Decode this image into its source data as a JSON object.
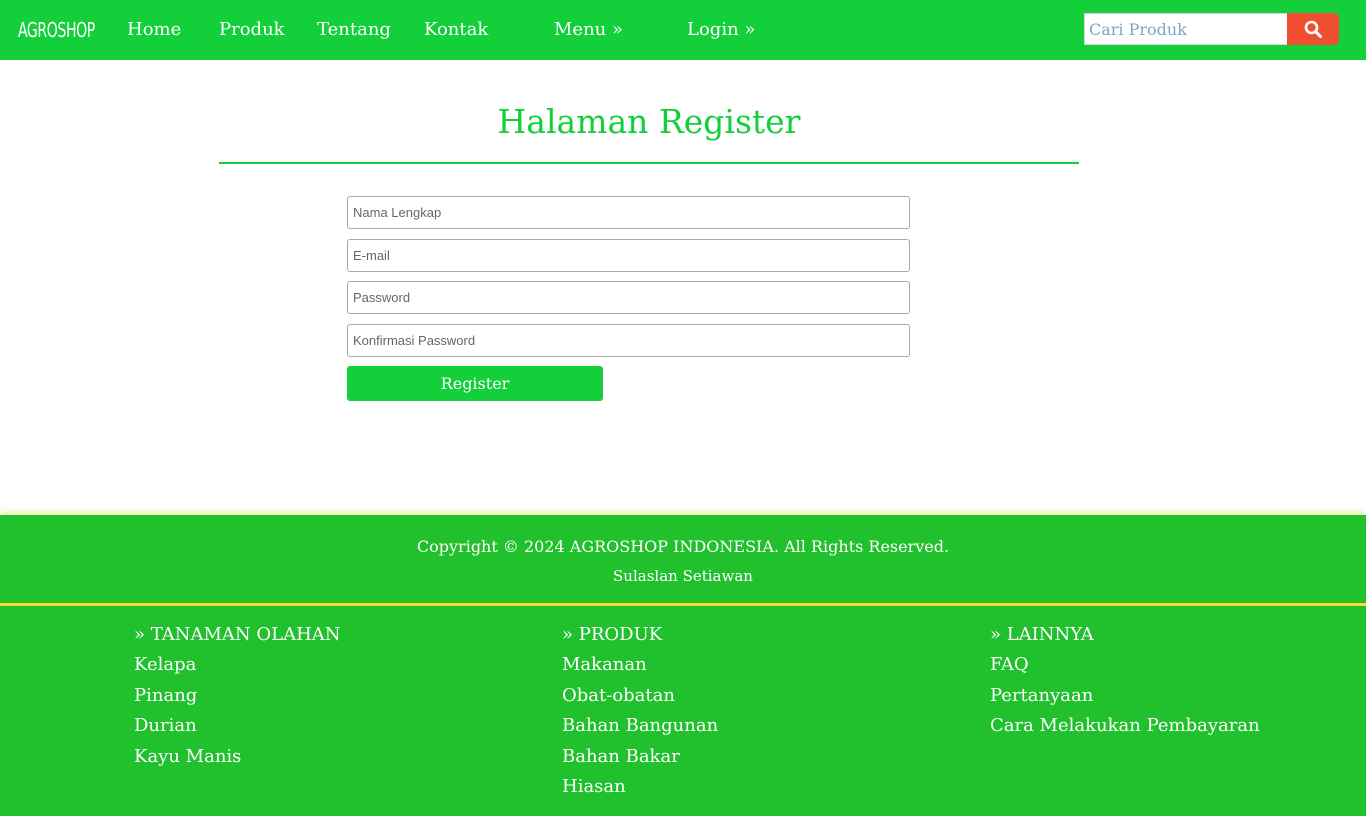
{
  "nav": {
    "brand": "AGROSHOP",
    "items": [
      "Home",
      "Produk",
      "Tentang",
      "Kontak",
      "Menu »",
      "Login »"
    ],
    "search_placeholder": "Cari Produk",
    "search_icon": "search-icon",
    "search_button_color": "#f04e30"
  },
  "colors": {
    "primary_green": "#13cf3a",
    "footer_green": "#21c02d",
    "footer_divider": "#ffd83a"
  },
  "main": {
    "title": "Halaman Register",
    "fields": {
      "full_name_placeholder": "Nama Lengkap",
      "email_placeholder": "E-mail",
      "password_placeholder": "Password",
      "confirm_password_placeholder": "Konfirmasi Password"
    },
    "register_label": "Register"
  },
  "footer": {
    "copyright": "Copyright © 2024 AGROSHOP INDONESIA. All Rights Reserved.",
    "author": "Sulaslan Setiawan",
    "columns": [
      {
        "heading": "» TANAMAN OLAHAN",
        "links": [
          "Kelapa",
          "Pinang",
          "Durian",
          "Kayu Manis"
        ]
      },
      {
        "heading": "» PRODUK",
        "links": [
          "Makanan",
          "Obat-obatan",
          "Bahan Bangunan",
          "Bahan Bakar",
          "Hiasan"
        ]
      },
      {
        "heading": "» LAINNYA",
        "links": [
          "FAQ",
          "Pertanyaan",
          "Cara Melakukan Pembayaran"
        ]
      }
    ]
  }
}
